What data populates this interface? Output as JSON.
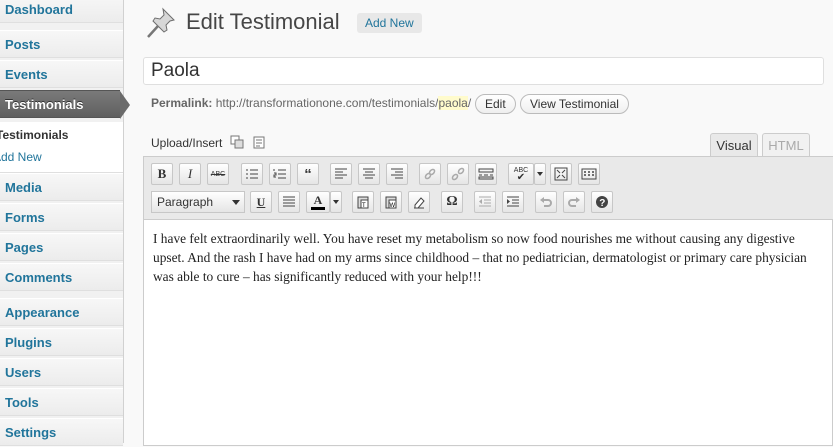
{
  "sidebar": {
    "items": [
      {
        "label": "Dashboard"
      },
      {
        "label": "Posts"
      },
      {
        "label": "Events"
      },
      {
        "label": "Testimonials"
      },
      {
        "label": "Media"
      },
      {
        "label": "Forms"
      },
      {
        "label": "Pages"
      },
      {
        "label": "Comments"
      },
      {
        "label": "Appearance"
      },
      {
        "label": "Plugins"
      },
      {
        "label": "Users"
      },
      {
        "label": "Tools"
      },
      {
        "label": "Settings"
      }
    ],
    "submenu": {
      "current": "Testimonials",
      "add_new": "Add New"
    }
  },
  "header": {
    "title": "Edit Testimonial",
    "add_new": "Add New"
  },
  "post": {
    "title": "Paola",
    "permalink_label": "Permalink:",
    "permalink_base": "http://transformationone.com/testimonials/",
    "permalink_slug": "paola",
    "permalink_trail": "/",
    "edit_button": "Edit",
    "view_button": "View Testimonial"
  },
  "editor": {
    "upload_label": "Upload/Insert",
    "tabs": {
      "visual": "Visual",
      "html": "HTML"
    },
    "format_select": "Paragraph",
    "toolbar_row1": [
      "bold-icon",
      "italic-icon",
      "strikethrough-icon",
      "bullet-list-icon",
      "numbered-list-icon",
      "blockquote-icon",
      "align-left-icon",
      "align-center-icon",
      "align-right-icon",
      "link-icon",
      "unlink-icon",
      "more-tag-icon",
      "spellcheck-icon",
      "fullscreen-icon",
      "kitchen-sink-icon"
    ],
    "toolbar_row2": [
      "underline-icon",
      "justify-icon",
      "text-color-icon",
      "paste-text-icon",
      "paste-word-icon",
      "clear-formatting-icon",
      "special-char-icon",
      "outdent-icon",
      "indent-icon",
      "undo-icon",
      "redo-icon",
      "help-icon"
    ],
    "content": "I have felt extraordinarily well. You have reset my metabolism so now food nourishes me without causing any digestive upset. And the rash I have had on my arms since childhood – that no pediatrician, dermatologist or primary care physician was able to cure – has significantly reduced with your help!!!"
  }
}
